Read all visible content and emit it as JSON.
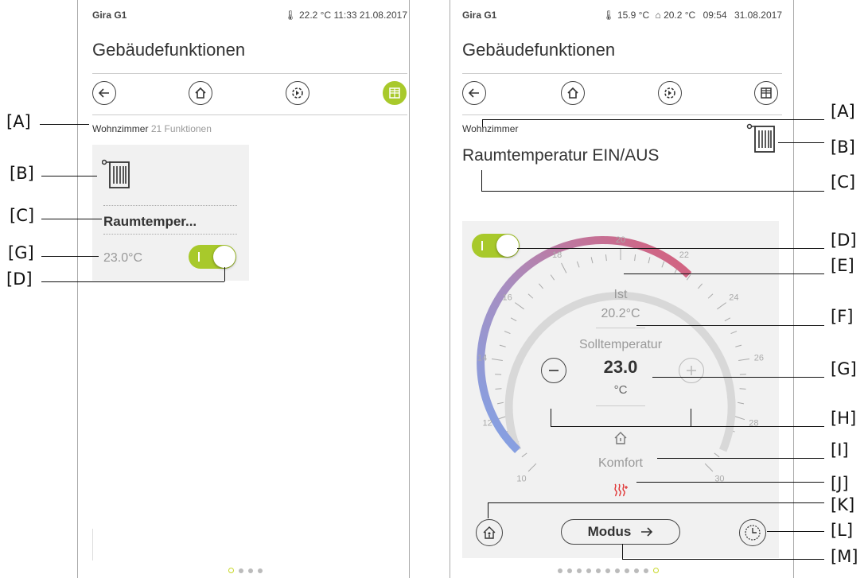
{
  "left": {
    "device": "Gira G1",
    "status": "22.2 °C   11:33   21.08.2017",
    "title": "Gebäudefunktionen",
    "room": "Wohnzimmer",
    "count": "21",
    "functions_label": "Funktionen",
    "tile_name": "Raumtemper...",
    "tile_temp": "23.0°C"
  },
  "right": {
    "device": "Gira G1",
    "status_outdoor": "15.9 °C",
    "status_indoor": "20.2 °C",
    "status_time": "09:54",
    "status_date": "31.08.2017",
    "title": "Gebäudefunktionen",
    "room": "Wohnzimmer",
    "heading": "Raumtemperatur EIN/AUS",
    "ist_label": "Ist",
    "ist_value": "20.2°C",
    "soll_label": "Solltemperatur",
    "soll_value": "23.0",
    "unit": "°C",
    "mode_label": "Komfort",
    "modus_button": "Modus",
    "scale": [
      "10",
      "12",
      "14",
      "16",
      "18",
      "20",
      "22",
      "24",
      "26",
      "28",
      "30"
    ]
  },
  "callouts": {
    "A": "[A]",
    "B": "[B]",
    "C": "[C]",
    "D": "[D]",
    "E": "[E]",
    "F": "[F]",
    "G": "[G]",
    "H": "[H]",
    "I": "[I]",
    "J": "[J]",
    "K": "[K]",
    "L": "[L]",
    "M": "[M]"
  },
  "colors": {
    "accent": "#a8c92b",
    "heating_red": "#e03030"
  }
}
